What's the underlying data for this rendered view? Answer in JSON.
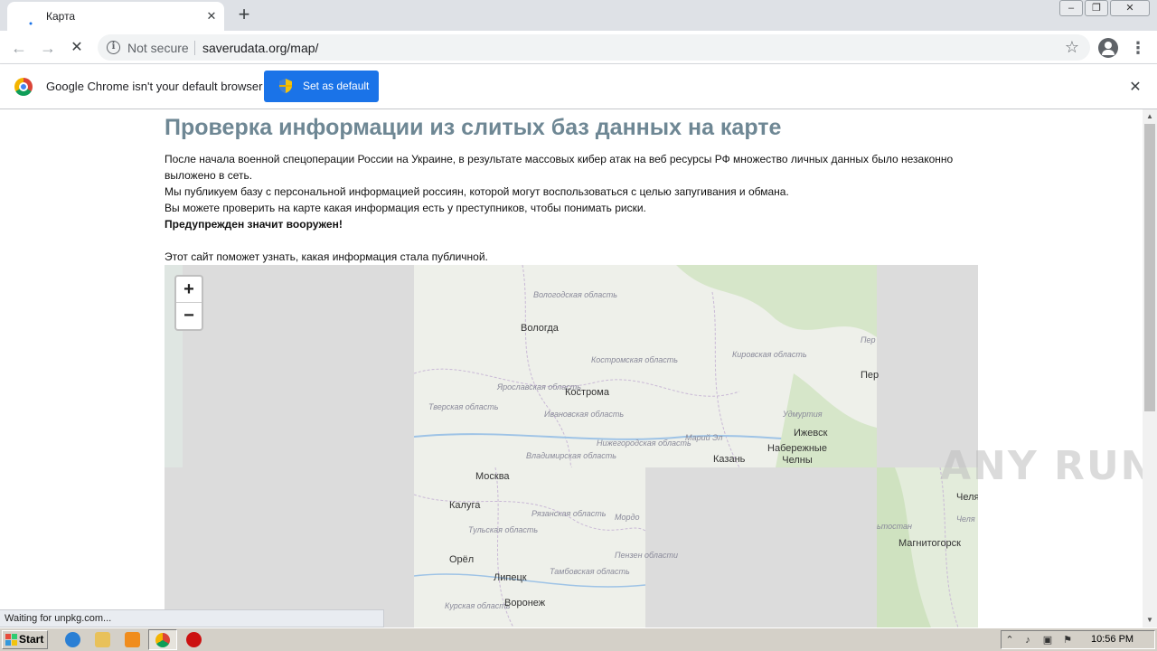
{
  "browser": {
    "tab_title": "Карта",
    "address": {
      "security_label": "Not secure",
      "url": "saverudata.org/map/"
    },
    "infobar": {
      "message": "Google Chrome isn't your default browser",
      "button_label": "Set as default"
    },
    "status_text": "Waiting for unpkg.com..."
  },
  "page": {
    "title": "Проверка информации из слитых баз данных на карте",
    "paragraphs": [
      "После начала военной спецоперации России на Украине, в результате массовых кибер атак на веб ресурсы РФ множество личных данных было незаконно выложено в сеть.",
      "Мы публикуем базу с персональной информацией россиян, которой могут воспользоваться с целью запугивания и обмана.",
      "Вы можете проверить на карте какая информация есть у преступников, чтобы понимать риски.",
      "Предупрежден значит вооружен!",
      "Этот сайт поможет узнать, какая информация стала публичной."
    ]
  },
  "map": {
    "zoom_in": "+",
    "zoom_out": "−",
    "cities": [
      "Вологда",
      "Кострома",
      "Москва",
      "Калуга",
      "Орёл",
      "Липецк",
      "Воронеж",
      "Казань",
      "Ижевск",
      "Набережные Челны",
      "Магнитогорск",
      "Пер",
      "Челя"
    ],
    "regions": [
      "Вологодская область",
      "Костромская область",
      "Ярославская область",
      "Тверская область",
      "Ивановская область",
      "Владимирская область",
      "Нижегородская область",
      "Кировская область",
      "Марий Эл",
      "Удмуртия",
      "Рязанская область",
      "Тульская область",
      "Тамбовская область",
      "Курская область",
      "Мордо",
      "Пензен области",
      "Пер",
      "ьтостан",
      "Челя"
    ]
  },
  "watermark": "ANY RUN",
  "taskbar": {
    "start_label": "Start",
    "clock": "10:56 PM"
  },
  "colors": {
    "title": "#6e8794",
    "accent_button": "#1a73e8",
    "map_background": "#dcdcdc",
    "taskbar": "#d4d0c8"
  }
}
